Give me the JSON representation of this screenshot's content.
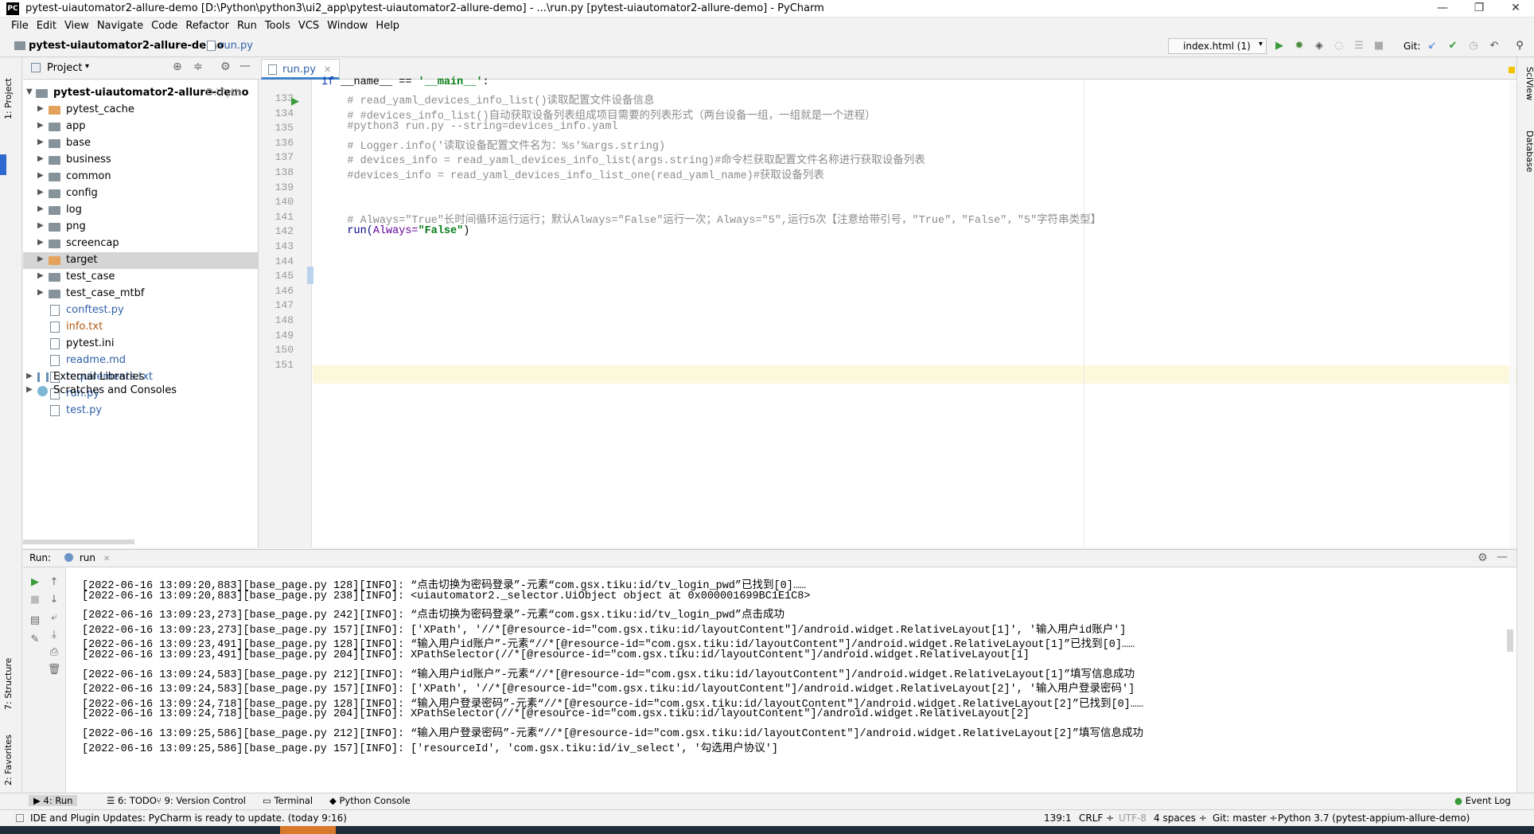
{
  "window": {
    "title": "pytest-uiautomator2-allure-demo [D:\\Python\\python3\\ui2_app\\pytest-uiautomator2-allure-demo] - ...\\run.py [pytest-uiautomator2-allure-demo] - PyCharm",
    "app_icon": "PC",
    "controls": [
      "—",
      "❐",
      "✕"
    ]
  },
  "menu": [
    "File",
    "Edit",
    "View",
    "Navigate",
    "Code",
    "Refactor",
    "Run",
    "Tools",
    "VCS",
    "Window",
    "Help"
  ],
  "navbar": {
    "project": "pytest-uiautomator2-allure-demo",
    "file": "run.py",
    "run_config": "index.html (1)",
    "git_label": "Git:"
  },
  "side_tabs": {
    "left_top": "1: Project",
    "left_structure": "7: Structure",
    "left_favorites": "2: Favorites",
    "right_sciview": "SciView",
    "right_database": "Database"
  },
  "project_panel": {
    "title": "Project",
    "root": "pytest-uiautomator2-allure-demo",
    "root_path": "D:\\Pyth",
    "items": [
      {
        "label": "pytest_cache",
        "kind": "folder-excluded",
        "expandable": true
      },
      {
        "label": "app",
        "kind": "folder",
        "expandable": true
      },
      {
        "label": "base",
        "kind": "folder",
        "expandable": true
      },
      {
        "label": "business",
        "kind": "folder",
        "expandable": true
      },
      {
        "label": "common",
        "kind": "folder",
        "expandable": true
      },
      {
        "label": "config",
        "kind": "folder",
        "expandable": true
      },
      {
        "label": "log",
        "kind": "folder",
        "expandable": true
      },
      {
        "label": "png",
        "kind": "folder",
        "expandable": true
      },
      {
        "label": "screencap",
        "kind": "folder",
        "expandable": true
      },
      {
        "label": "target",
        "kind": "folder-excluded",
        "expandable": true,
        "selected": true
      },
      {
        "label": "test_case",
        "kind": "folder",
        "expandable": true
      },
      {
        "label": "test_case_mtbf",
        "kind": "folder",
        "expandable": true
      },
      {
        "label": "conftest.py",
        "kind": "python-file",
        "color": "#2f5fa8"
      },
      {
        "label": "info.txt",
        "kind": "text-file",
        "color": "#b25a0f"
      },
      {
        "label": "pytest.ini",
        "kind": "ini-file",
        "color": "#000000"
      },
      {
        "label": "readme.md",
        "kind": "markdown-file",
        "color": "#2f5fa8"
      },
      {
        "label": "requirements.txt",
        "kind": "text-file",
        "color": "#2f5fa8"
      },
      {
        "label": "run.py",
        "kind": "python-file",
        "color": "#2f5fa8"
      },
      {
        "label": "test.py",
        "kind": "python-file",
        "color": "#2f5fa8"
      }
    ],
    "external_libraries": "External Libraries",
    "scratches": "Scratches and Consoles"
  },
  "editor": {
    "tab": "run.py",
    "line_numbers": [
      "133",
      "134",
      "135",
      "136",
      "137",
      "138",
      "139",
      "140",
      "141",
      "142",
      "143",
      "144",
      "145",
      "146",
      "147",
      "148",
      "149",
      "150",
      "151"
    ],
    "code": {
      "l133_kw": "if",
      "l133_a": " __name__ == ",
      "l133_str": "'__main__'",
      "l133_b": ":",
      "l134": "    # read_yaml_devices_info_list()读取配置文件设备信息",
      "l135": "    # #devices_info_list()自动获取设备列表组成项目需要的列表形式（两台设备一组，一组就是一个进程）",
      "l136": "    #python3 run.py --string=devices_info.yaml",
      "l137": "    # Logger.info('读取设备配置文件名为：%s'%args.string)",
      "l138": "    # devices_info = read_yaml_devices_info_list(args.string)#命令栏获取配置文件名称进行获取设备列表",
      "l139": "    #devices_info = read_yaml_devices_info_list_one(read_yaml_name)#获取设备列表",
      "l142": "    # Always=\"True\"长时间循环运行运行；默认Always=\"False\"运行一次；Always=\"5\",运行5次【注意给带引号，\"True\"，\"False\"，\"5\"字符串类型】",
      "l143_fn": "    run(",
      "l143_param": "Always=",
      "l143_str": "\"False\"",
      "l143_end": ")"
    }
  },
  "run_panel": {
    "label": "Run:",
    "tab": "run",
    "lines": [
      "[2022-06-16 13:09:20,883][base_page.py 128][INFO]: “点击切换为密码登录”-元素“com.gsx.tiku:id/tv_login_pwd”已找到[0]……",
      "[2022-06-16 13:09:20,883][base_page.py 238][INFO]: <uiautomator2._selector.UiObject object at 0x000001699BC1E1C8>",
      "[2022-06-16 13:09:23,273][base_page.py 242][INFO]: “点击切换为密码登录”-元素“com.gsx.tiku:id/tv_login_pwd”点击成功",
      "[2022-06-16 13:09:23,273][base_page.py 157][INFO]: ['XPath', '//*[@resource-id=\"com.gsx.tiku:id/layoutContent\"]/android.widget.RelativeLayout[1]', '输入用户id账户']",
      "[2022-06-16 13:09:23,491][base_page.py 128][INFO]: “输入用户id账户”-元素“//*[@resource-id=\"com.gsx.tiku:id/layoutContent\"]/android.widget.RelativeLayout[1]”已找到[0]……",
      "[2022-06-16 13:09:23,491][base_page.py 204][INFO]: XPathSelector(//*[@resource-id=\"com.gsx.tiku:id/layoutContent\"]/android.widget.RelativeLayout[1]",
      "[2022-06-16 13:09:24,583][base_page.py 212][INFO]: “输入用户id账户”-元素“//*[@resource-id=\"com.gsx.tiku:id/layoutContent\"]/android.widget.RelativeLayout[1]”填写信息成功",
      "[2022-06-16 13:09:24,583][base_page.py 157][INFO]: ['XPath', '//*[@resource-id=\"com.gsx.tiku:id/layoutContent\"]/android.widget.RelativeLayout[2]', '输入用户登录密码']",
      "[2022-06-16 13:09:24,718][base_page.py 128][INFO]: “输入用户登录密码”-元素“//*[@resource-id=\"com.gsx.tiku:id/layoutContent\"]/android.widget.RelativeLayout[2]”已找到[0]……",
      "[2022-06-16 13:09:24,718][base_page.py 204][INFO]: XPathSelector(//*[@resource-id=\"com.gsx.tiku:id/layoutContent\"]/android.widget.RelativeLayout[2]",
      "[2022-06-16 13:09:25,586][base_page.py 212][INFO]: “输入用户登录密码”-元素“//*[@resource-id=\"com.gsx.tiku:id/layoutContent\"]/android.widget.RelativeLayout[2]”填写信息成功",
      "[2022-06-16 13:09:25,586][base_page.py 157][INFO]: ['resourceId', 'com.gsx.tiku:id/iv_select', '勾选用户协议']"
    ]
  },
  "bottom_tabs": [
    "4: Run",
    "6: TODO",
    "9: Version Control",
    "Terminal",
    "Python Console"
  ],
  "event_log": "Event Log",
  "status": {
    "message": "IDE and Plugin Updates: PyCharm is ready to update. (today 9:16)",
    "position": "139:1",
    "line_sep": "CRLF ÷",
    "encoding": "UTF-8",
    "indent": "4 spaces ÷",
    "git": "Git: master ÷",
    "interpreter": "Python 3.7 (pytest-appium-allure-demo)"
  }
}
